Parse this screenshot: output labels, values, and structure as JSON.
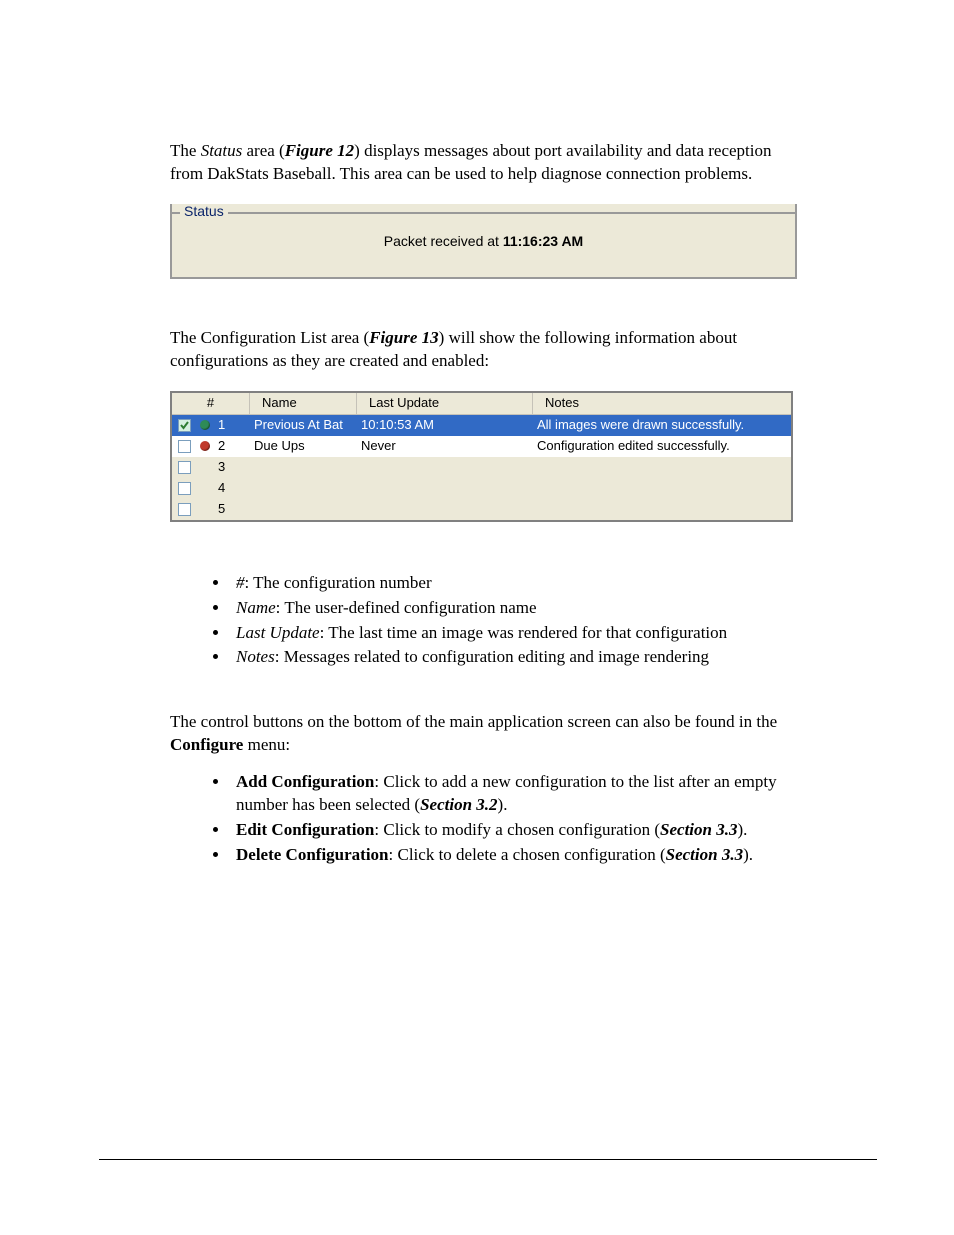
{
  "para1": {
    "pre": "The ",
    "status": "Status",
    "mid": " area (",
    "fig": "Figure 12",
    "post": ") displays messages about port availability and data reception from DakStats Baseball. This area can be used to help diagnose connection problems."
  },
  "statusBox": {
    "legend": "Status",
    "msgPre": "Packet received at ",
    "time": "11:16:23 AM"
  },
  "para2": {
    "pre": "The Configuration List area (",
    "fig": "Figure 13",
    "post": ") will show the following information about configurations as they are created and enabled:"
  },
  "grid": {
    "headers": {
      "num": "#",
      "name": "Name",
      "upd": "Last Update",
      "notes": "Notes"
    },
    "rows": [
      {
        "checked": true,
        "ind": "green",
        "num": "1",
        "name": "Previous At Bat",
        "upd": "10:10:53 AM",
        "notes": "All images were drawn successfully.",
        "selected": true
      },
      {
        "checked": false,
        "ind": "red",
        "num": "2",
        "name": "Due Ups",
        "upd": "Never",
        "notes": "Configuration edited successfully.",
        "selected": false
      },
      {
        "checked": false,
        "ind": "",
        "num": "3",
        "name": "",
        "upd": "",
        "notes": "",
        "selected": false
      },
      {
        "checked": false,
        "ind": "",
        "num": "4",
        "name": "",
        "upd": "",
        "notes": "",
        "selected": false
      },
      {
        "checked": false,
        "ind": "",
        "num": "5",
        "name": "",
        "upd": "",
        "notes": "",
        "selected": false
      }
    ]
  },
  "defs": [
    {
      "label": " #",
      "text": ": The configuration number"
    },
    {
      "label": "Name",
      "text": ": The user-defined configuration name"
    },
    {
      "label": "Last Update",
      "text": ": The last time an image was rendered for that configuration"
    },
    {
      "label": "Notes",
      "text": ": Messages related to configuration editing and image rendering"
    }
  ],
  "para3": {
    "pre": "The control buttons on the bottom of the main application screen can also be found in the ",
    "conf": "Configure",
    "post": " menu:"
  },
  "ops": [
    {
      "label": "Add Configuration",
      "text": ": Click to add a new configuration to the list after an empty number has been selected (",
      "ref": "Section 3.2",
      "tail": ")."
    },
    {
      "label": "Edit Configuration",
      "text": ": Click to modify a chosen configuration (",
      "ref": "Section 3.3",
      "tail": ")."
    },
    {
      "label": "Delete Configuration",
      "text": ": Click to delete a chosen configuration (",
      "ref": "Section 3.3",
      "tail": ")."
    }
  ]
}
